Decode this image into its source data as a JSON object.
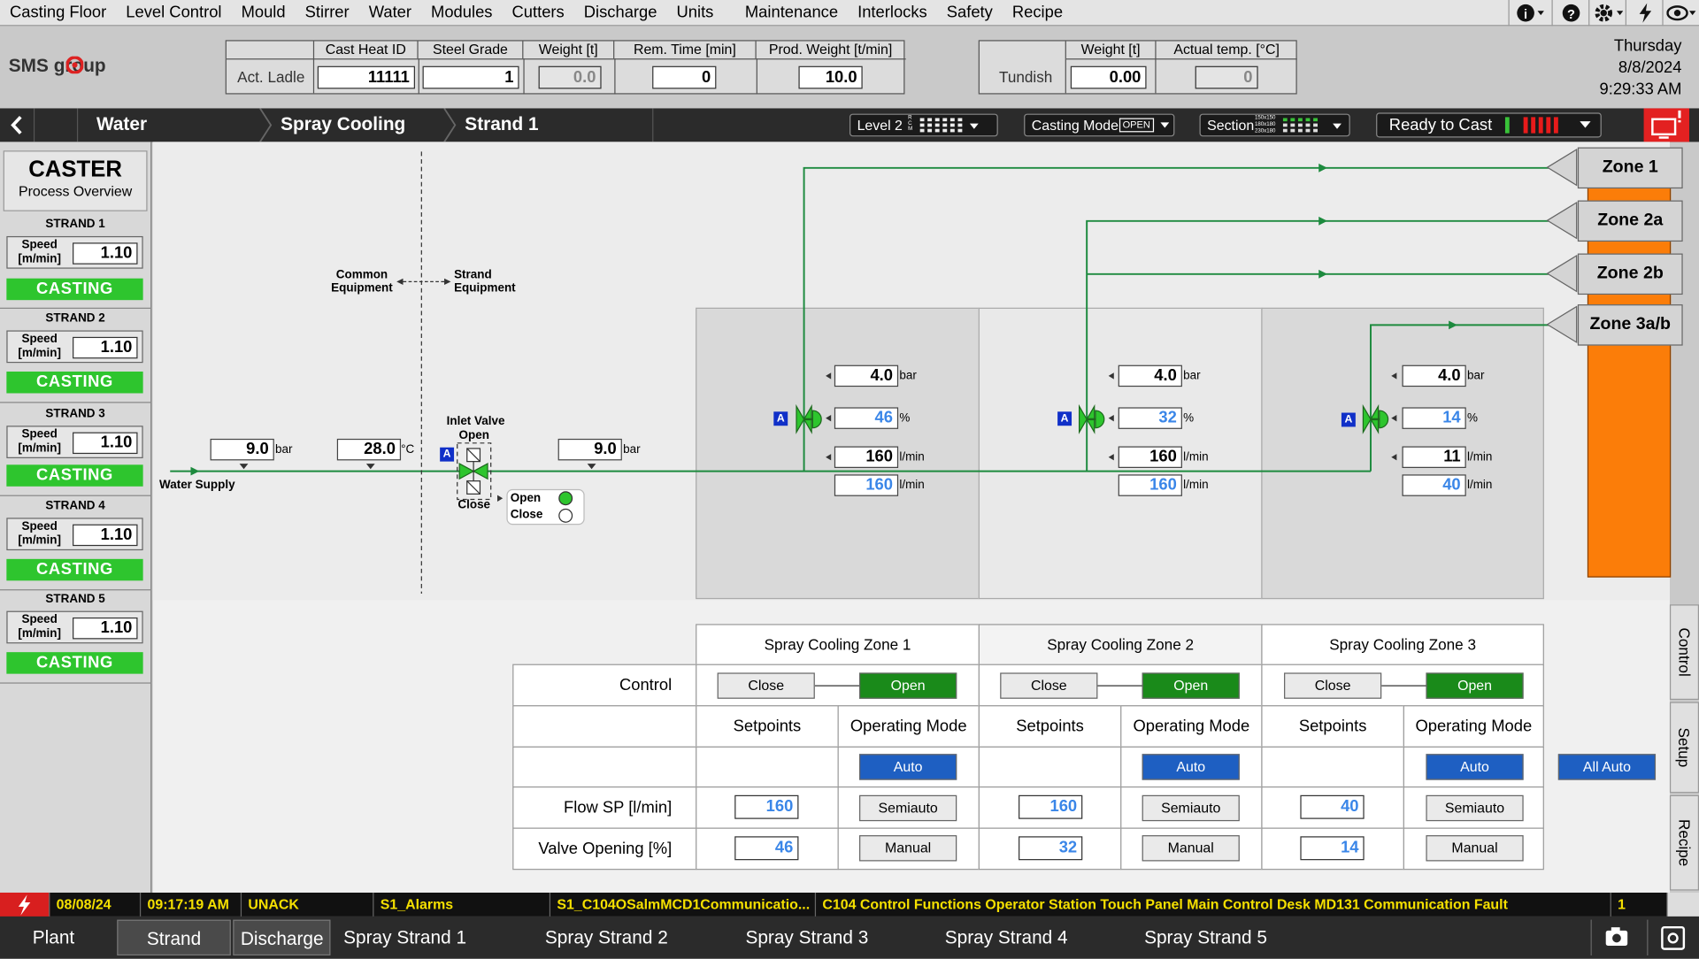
{
  "menu": [
    "Casting Floor",
    "Level Control",
    "Mould",
    "Stirrer",
    "Water",
    "Modules",
    "Cutters",
    "Discharge",
    "Units",
    "Maintenance",
    "Interlocks",
    "Safety",
    "Recipe"
  ],
  "menu_icons": [
    "info-icon",
    "help-icon",
    "gear-icon",
    "lightning-icon",
    "eye-icon"
  ],
  "logo": "SMS group",
  "ladle": {
    "row_label": "Act. Ladle",
    "headers": [
      "Cast Heat ID",
      "Steel Grade",
      "Weight [t]",
      "Rem. Time [min]",
      "Prod. Weight [t/min]"
    ],
    "cast_heat_id": "11111",
    "steel_grade": "1",
    "weight": "0.0",
    "rem_time": "0",
    "prod_weight": "10.0"
  },
  "tundish": {
    "row_label": "Tundish",
    "headers": [
      "Weight [t]",
      "Actual temp. [°C]"
    ],
    "weight": "0.00",
    "temp": "0"
  },
  "datetime": {
    "day": "Thursday",
    "date": "8/8/2024",
    "time": "9:29:33 AM"
  },
  "breadcrumb": [
    "Water",
    "Spray Cooling",
    "Strand 1"
  ],
  "nav_pills": {
    "level": "Level 2",
    "level_small": [
      "R",
      "C",
      "M"
    ],
    "level_small2": [
      "H",
      "M"
    ],
    "casting_mode": "Casting Mode",
    "casting_mode_val": "OPEN",
    "section": "Section",
    "section_small": [
      "150x150",
      "180x180",
      "230x180"
    ],
    "ready": "Ready to Cast"
  },
  "caster": {
    "title": "CASTER",
    "subtitle": "Process Overview"
  },
  "strands": [
    {
      "name": "STRAND 1",
      "speed_label": "Speed [m/min]",
      "speed": "1.10",
      "status": "CASTING"
    },
    {
      "name": "STRAND 2",
      "speed_label": "Speed [m/min]",
      "speed": "1.10",
      "status": "CASTING"
    },
    {
      "name": "STRAND 3",
      "speed_label": "Speed [m/min]",
      "speed": "1.10",
      "status": "CASTING"
    },
    {
      "name": "STRAND 4",
      "speed_label": "Speed [m/min]",
      "speed": "1.10",
      "status": "CASTING"
    },
    {
      "name": "STRAND 5",
      "speed_label": "Speed [m/min]",
      "speed": "1.10",
      "status": "CASTING"
    }
  ],
  "diagram": {
    "water_supply": "Water Supply",
    "common": "Common Equipment",
    "strand_eq": "Strand Equipment",
    "supply_pressure": "9.0",
    "supply_temp": "28.0",
    "after_valve_pressure": "9.0",
    "unit_bar": "bar",
    "unit_temp": "°C",
    "unit_pct": "%",
    "unit_flow": "l/min",
    "inlet_valve": "Inlet Valve",
    "inlet_open": "Open",
    "inlet_close": "Close",
    "legend_open": "Open",
    "legend_close": "Close",
    "auto_badge": "A",
    "zones": [
      {
        "pressure": "4.0",
        "valve": "46",
        "flow_act": "160",
        "flow_sp": "160"
      },
      {
        "pressure": "4.0",
        "valve": "32",
        "flow_act": "160",
        "flow_sp": "160"
      },
      {
        "pressure": "4.0",
        "valve": "14",
        "flow_act": "11",
        "flow_sp": "40"
      }
    ],
    "zone_buttons": [
      "Zone 1",
      "Zone 2a",
      "Zone 2b",
      "Zone 3a/b"
    ]
  },
  "control": {
    "zone_headers": [
      "Spray Cooling Zone 1",
      "Spray Cooling Zone 2",
      "Spray Cooling Zone 3"
    ],
    "control_label": "Control",
    "close_label": "Close",
    "open_label": "Open",
    "setpoints_label": "Setpoints",
    "mode_label": "Operating Mode",
    "auto": "Auto",
    "semiauto": "Semiauto",
    "manual": "Manual",
    "all_auto": "All Auto",
    "flow_sp_label": "Flow SP [l/min]",
    "valve_label": "Valve Opening [%]",
    "flow_sp": [
      "160",
      "160",
      "40"
    ],
    "valve_op": [
      "46",
      "32",
      "14"
    ]
  },
  "right_tabs": [
    "Control",
    "Setup",
    "Recipe"
  ],
  "alarm": {
    "date": "08/08/24",
    "time": "09:17:19 AM",
    "state": "UNACK",
    "group": "S1_Alarms",
    "tag": "S1_C104OSalmMCD1Communicatio...",
    "message": "C104 Control Functions Operator Station Touch Panel Main Control Desk MD131 Communication Fault",
    "count": "1"
  },
  "bottom_nav": [
    "Plant",
    "Strand",
    "Discharge",
    "Spray Strand 1",
    "Spray Strand 2",
    "Spray Strand 3",
    "Spray Strand 4",
    "Spray Strand 5"
  ]
}
